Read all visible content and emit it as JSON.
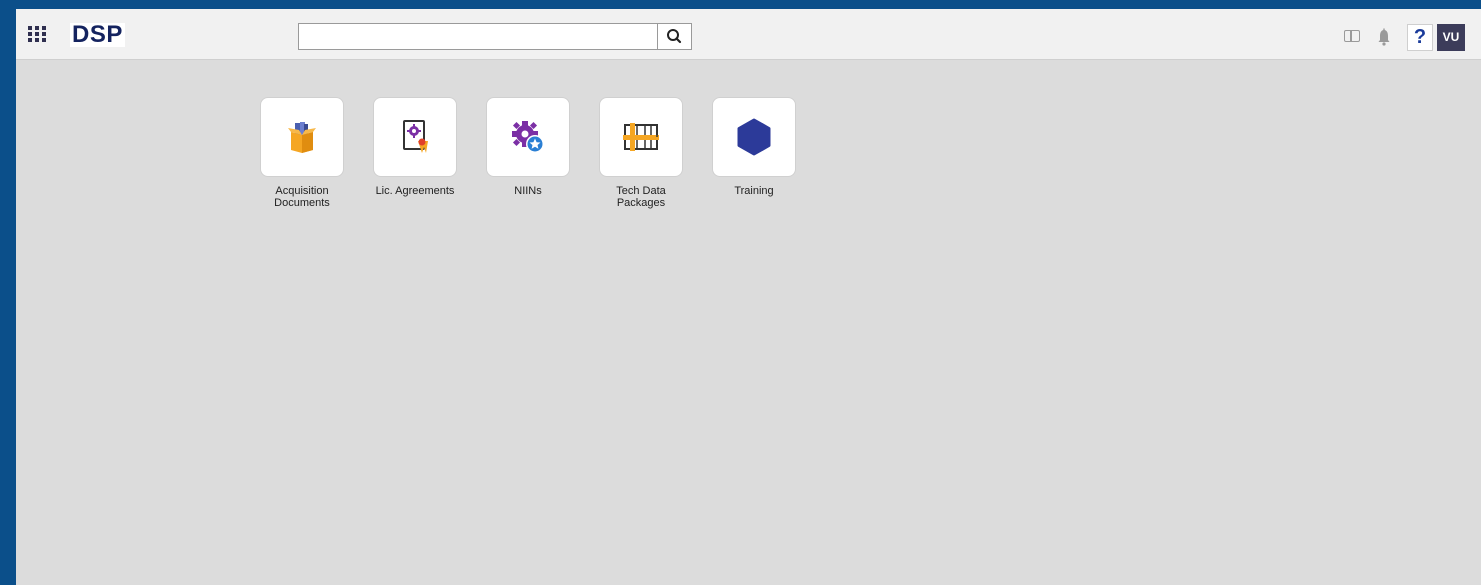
{
  "header": {
    "logo": "DSP",
    "search": {
      "value": "",
      "placeholder": ""
    },
    "avatar_initials": "VU",
    "help_label": "?"
  },
  "tiles": [
    {
      "label": "Acquisition Documents",
      "icon": "open-box-icon"
    },
    {
      "label": "Lic. Agreements",
      "icon": "certificate-icon"
    },
    {
      "label": "NIINs",
      "icon": "gear-star-icon"
    },
    {
      "label": "Tech Data Packages",
      "icon": "blueprint-icon"
    },
    {
      "label": "Training",
      "icon": "hexagon-icon"
    }
  ],
  "colors": {
    "frame": "#0b4f8a",
    "background": "#dcdcdc",
    "topbar": "#f1f1f1",
    "logo": "#14235f",
    "avatar": "#3c3c5a"
  }
}
